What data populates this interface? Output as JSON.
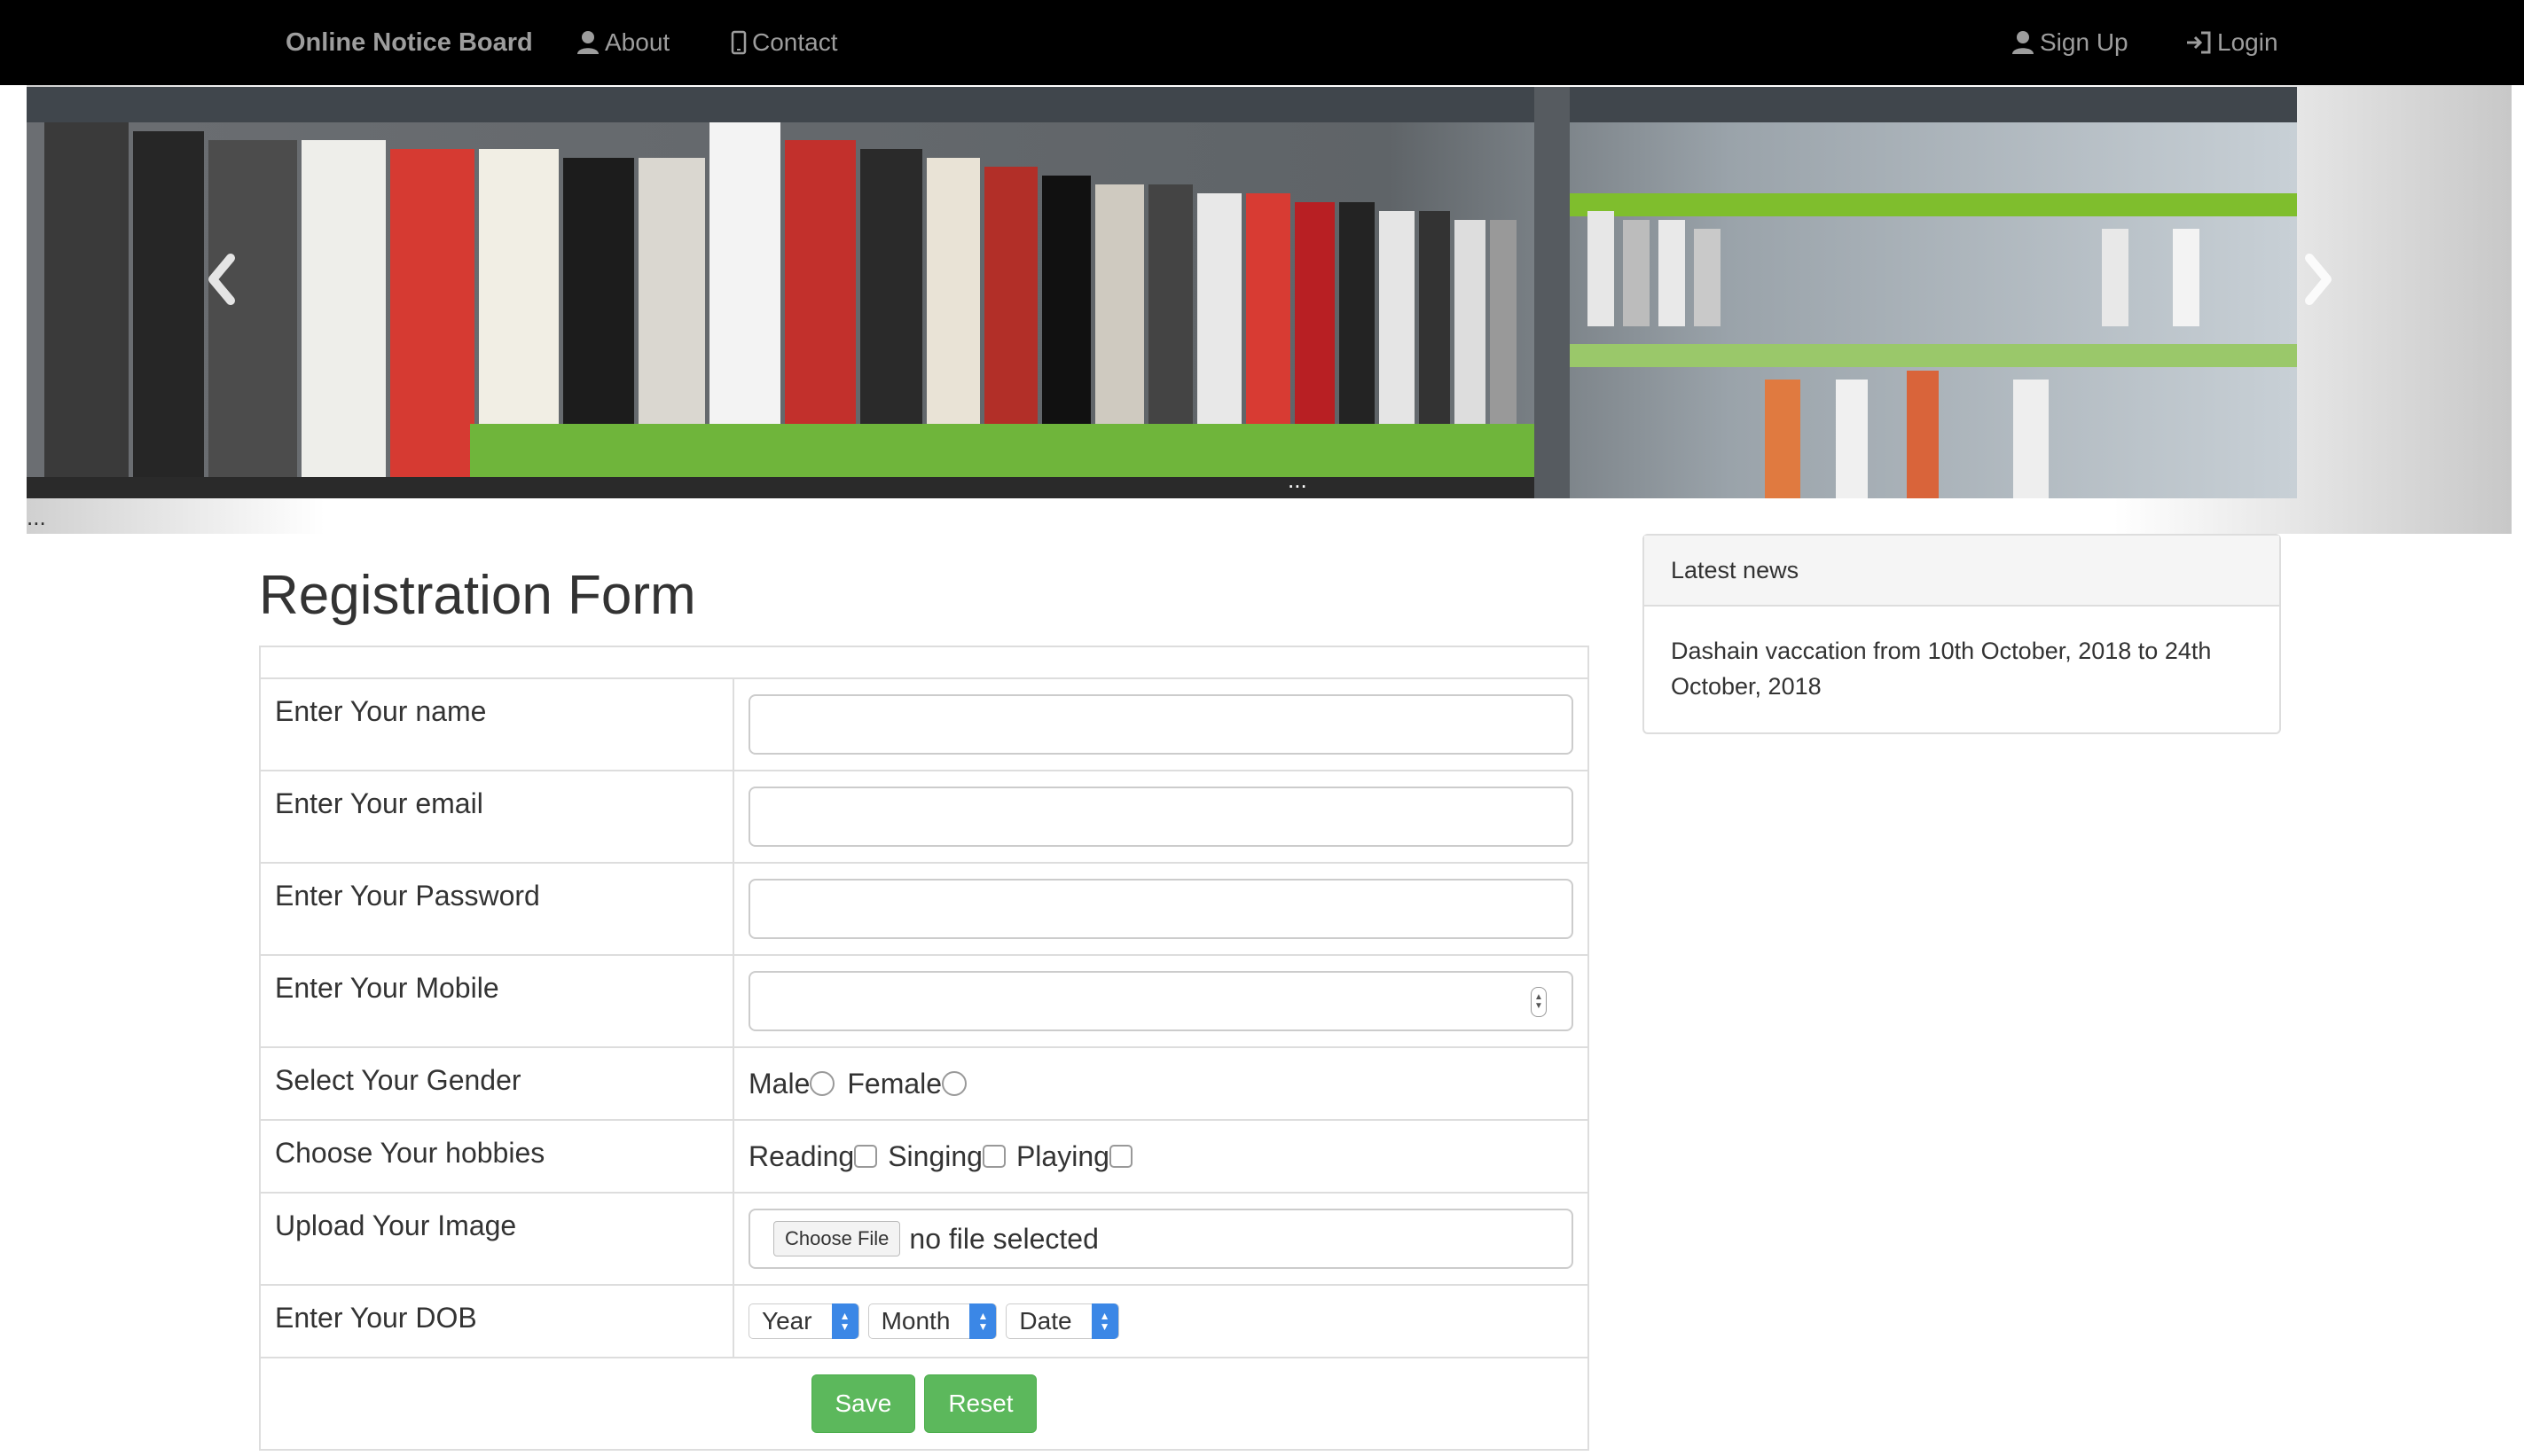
{
  "navbar": {
    "brand": "Online Notice Board",
    "about": "About",
    "contact": "Contact",
    "signup": "Sign Up",
    "login": "Login"
  },
  "carousel": {
    "overlay_ellipsis": "...",
    "below_ellipsis": "...",
    "slide_count": 3,
    "active_slide": 3
  },
  "form": {
    "title": "Registration Form",
    "fields": {
      "name": {
        "label": "Enter Your name",
        "value": ""
      },
      "email": {
        "label": "Enter Your email",
        "value": ""
      },
      "password": {
        "label": "Enter Your Password",
        "value": ""
      },
      "mobile": {
        "label": "Enter Your Mobile",
        "value": ""
      },
      "gender": {
        "label": "Select Your Gender",
        "options": [
          "Male",
          "Female"
        ]
      },
      "hobbies": {
        "label": "Choose Your hobbies",
        "options": [
          "Reading",
          "Singing",
          "Playing"
        ]
      },
      "image": {
        "label": "Upload Your Image",
        "button": "Choose File",
        "status": "no file selected"
      },
      "dob": {
        "label": "Enter Your DOB",
        "year": "Year",
        "month": "Month",
        "date": "Date"
      }
    },
    "save": "Save",
    "reset": "Reset"
  },
  "news": {
    "heading": "Latest news",
    "item": "Dashain vaccation from 10th October, 2018 to 24th October, 2018"
  },
  "colors": {
    "navbar_bg": "#000000",
    "nav_text": "#9d9d9d",
    "button_green": "#5cb85c",
    "select_blue": "#3b87e6"
  }
}
